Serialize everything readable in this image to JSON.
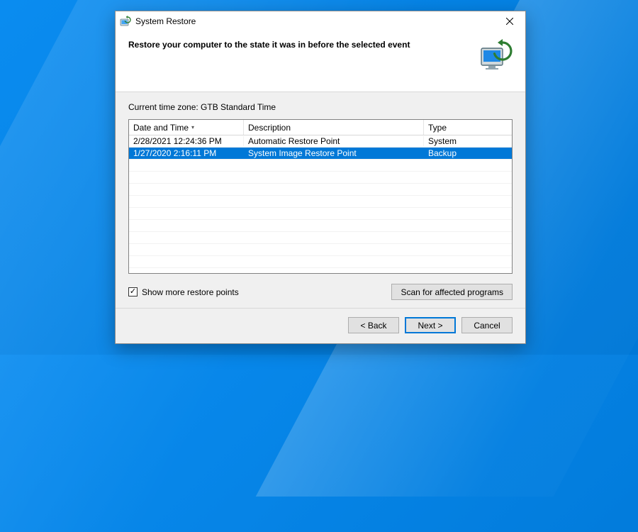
{
  "window": {
    "title": "System Restore"
  },
  "header": {
    "instruction": "Restore your computer to the state it was in before the selected event"
  },
  "timezone": {
    "label": "Current time zone: GTB Standard Time"
  },
  "table": {
    "columns": {
      "datetime": "Date and Time",
      "description": "Description",
      "type": "Type"
    },
    "sort_column": "datetime",
    "sort_dir": "desc",
    "rows": [
      {
        "datetime": "2/28/2021 12:24:36 PM",
        "description": "Automatic Restore Point",
        "type": "System",
        "selected": false
      },
      {
        "datetime": "1/27/2020 2:16:11 PM",
        "description": "System Image Restore Point",
        "type": "Backup",
        "selected": true
      }
    ]
  },
  "checkbox": {
    "label": "Show more restore points",
    "checked": true
  },
  "buttons": {
    "scan": "Scan for affected programs",
    "back": "< Back",
    "next": "Next >",
    "cancel": "Cancel"
  },
  "icons": {
    "title": "restore-small-icon",
    "header": "restore-large-icon",
    "close": "close-icon"
  },
  "colors": {
    "selection": "#0078d7",
    "desktop": "#0078d7"
  }
}
